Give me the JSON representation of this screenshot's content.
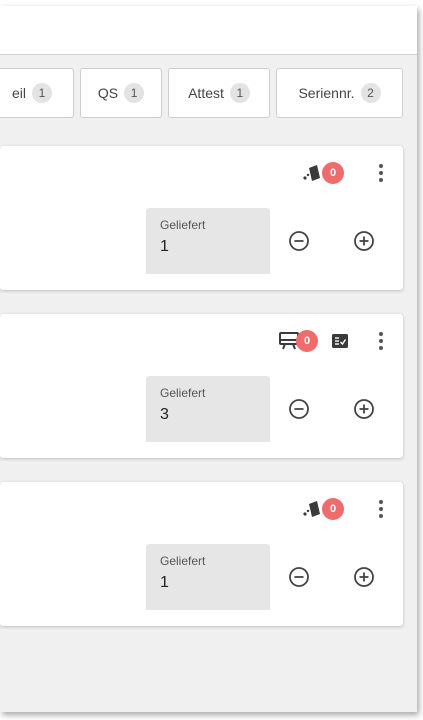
{
  "tabs": [
    {
      "label": "eil",
      "count": "1"
    },
    {
      "label": "QS",
      "count": "1"
    },
    {
      "label": "Attest",
      "count": "1"
    },
    {
      "label": "Seriennr.",
      "count": "2"
    }
  ],
  "cards": [
    {
      "status_icon": "tag-icon",
      "badge_count": "0",
      "field_label": "Geliefert",
      "field_value": "1"
    },
    {
      "status_icon": "monitor-icon",
      "badge_count": "0",
      "extra_icon": "checklist-icon",
      "field_label": "Geliefert",
      "field_value": "3"
    },
    {
      "status_icon": "tag-icon",
      "badge_count": "0",
      "field_label": "Geliefert",
      "field_value": "1"
    }
  ],
  "colors": {
    "badge_red": "#f06b6b",
    "tab_badge_gray": "#e3e3e3",
    "field_bg": "#e6e6e6",
    "page_bg": "#f0f0f0"
  }
}
